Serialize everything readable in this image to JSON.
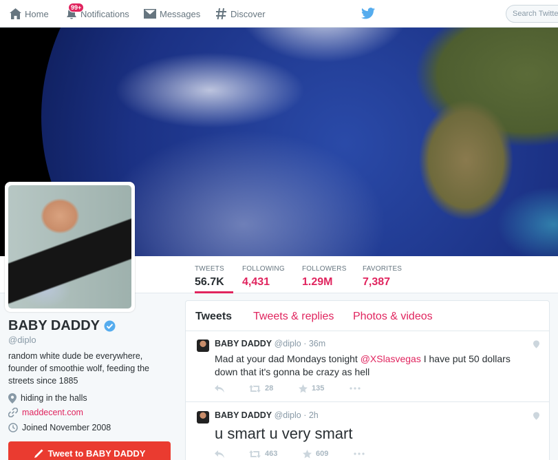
{
  "nav": {
    "home": "Home",
    "notifications": "Notifications",
    "notifications_badge": "99+",
    "messages": "Messages",
    "discover": "Discover",
    "search_placeholder": "Search Twitter"
  },
  "profile": {
    "name": "BABY DADDY",
    "handle": "@diplo",
    "bio": "random white dude be everywhere, founder of smoothie wolf, feeding the streets since 1885",
    "location": "hiding in the halls",
    "website": "maddecent.com",
    "joined": "Joined November 2008",
    "tweet_to_label": "Tweet to BABY DADDY"
  },
  "stats": [
    {
      "label": "TWEETS",
      "value": "56.7K"
    },
    {
      "label": "FOLLOWING",
      "value": "4,431"
    },
    {
      "label": "FOLLOWERS",
      "value": "1.29M"
    },
    {
      "label": "FAVORITES",
      "value": "7,387"
    }
  ],
  "timeline": {
    "tabs": [
      "Tweets",
      "Tweets & replies",
      "Photos & videos"
    ],
    "active_tab": "Tweets",
    "tweets": [
      {
        "name": "BABY DADDY",
        "handle": "@diplo",
        "time": "36m",
        "text_before": "Mad at your dad Mondays tonight ",
        "mention": "@XSlasvegas",
        "text_after": " I have put 50 dollars down that it's gonna be crazy as hell",
        "retweets": "28",
        "favorites": "135"
      },
      {
        "name": "BABY DADDY",
        "handle": "@diplo",
        "time": "2h",
        "text": "u smart u very smart",
        "retweets": "463",
        "favorites": "609"
      }
    ]
  },
  "colors": {
    "accent": "#e0245e",
    "tweet_button": "#ea3b30",
    "twitter_blue": "#55acee"
  }
}
